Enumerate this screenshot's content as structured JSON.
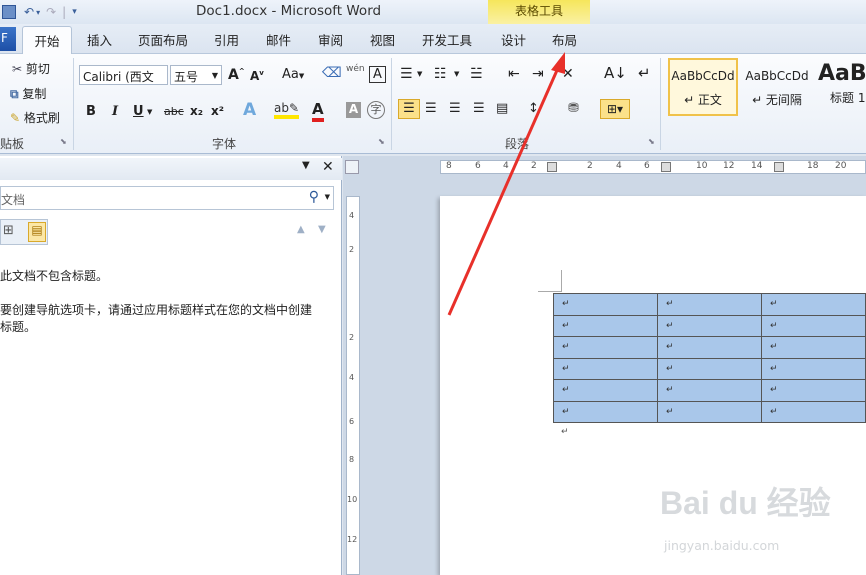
{
  "title": "Doc1.docx - Microsoft Word",
  "context_tab_group": "表格工具",
  "tabs": {
    "file": "F",
    "home": "开始",
    "insert": "插入",
    "page_layout": "页面布局",
    "references": "引用",
    "mailings": "邮件",
    "review": "审阅",
    "view": "视图",
    "developer": "开发工具",
    "design": "设计",
    "layout": "布局"
  },
  "clipboard": {
    "cut": "剪切",
    "copy": "复制",
    "format_painter": "格式刷",
    "label": "贴板"
  },
  "font": {
    "name": "Calibri (西文",
    "size": "五号",
    "label": "字体",
    "change_case": "Aa",
    "grow": "A",
    "shrink": "A",
    "bold": "B",
    "italic": "I",
    "underline": "U",
    "strike": "abc",
    "sub": "x₂",
    "sup": "x²",
    "phonetic": "wén",
    "clear": "A"
  },
  "paragraph": {
    "label": "段落"
  },
  "styles": {
    "items": [
      {
        "preview": "AaBbCcDd",
        "name": "↵ 正文"
      },
      {
        "preview": "AaBbCcDd",
        "name": "↵ 无间隔"
      },
      {
        "preview": "AaB",
        "name": "标题 1"
      }
    ]
  },
  "nav": {
    "search_placeholder": "文档",
    "no_headings": "此文档不包含标题。",
    "hint_line1": "要创建导航选项卡，请通过应用标题样式在您的文档中创建",
    "hint_line2": "标题。"
  },
  "ruler": {
    "h_ticks": [
      "8",
      "6",
      "4",
      "2",
      "2",
      "4",
      "6",
      "10",
      "12",
      "14",
      "18",
      "20"
    ],
    "v_ticks": [
      "4",
      "2",
      "2",
      "4",
      "6",
      "8",
      "10",
      "12"
    ]
  },
  "table": {
    "rows": 6,
    "cols": 3,
    "cell_mark": "↵",
    "after_mark": "↵"
  },
  "watermark": {
    "text": "Bai du 经验",
    "sub": "jingyan.baidu.com"
  }
}
